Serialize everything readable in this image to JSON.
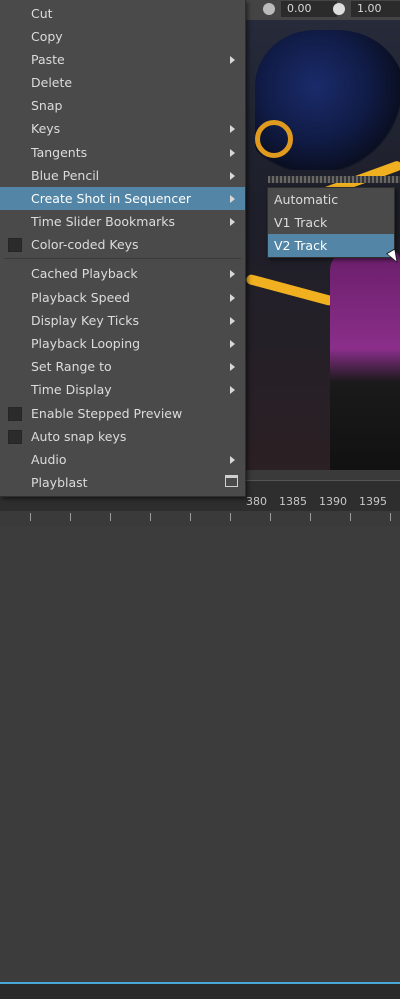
{
  "viewport": {
    "field_left": "0.00",
    "field_right": "1.00"
  },
  "menu": {
    "items": [
      {
        "label": "Cut",
        "submenu": false
      },
      {
        "label": "Copy",
        "submenu": false
      },
      {
        "label": "Paste",
        "submenu": true
      },
      {
        "label": "Delete",
        "submenu": false
      },
      {
        "label": "Snap",
        "submenu": false
      },
      {
        "label": "Keys",
        "submenu": true
      },
      {
        "label": "Tangents",
        "submenu": true
      },
      {
        "label": "Blue Pencil",
        "submenu": true
      },
      {
        "label": "Create Shot in Sequencer",
        "submenu": true,
        "active": true
      },
      {
        "label": "Time Slider Bookmarks",
        "submenu": true
      },
      {
        "label": "Color-coded Keys",
        "checkbox": true
      },
      {
        "label": "Cached Playback",
        "submenu": true
      },
      {
        "label": "Playback Speed",
        "submenu": true
      },
      {
        "label": "Display Key Ticks",
        "submenu": true
      },
      {
        "label": "Playback Looping",
        "submenu": true
      },
      {
        "label": "Set Range to",
        "submenu": true
      },
      {
        "label": "Time Display",
        "submenu": true
      },
      {
        "label": "Enable Stepped Preview",
        "checkbox": true
      },
      {
        "label": "Auto snap keys",
        "checkbox": true
      },
      {
        "label": "Audio",
        "submenu": true
      },
      {
        "label": "Playblast",
        "option_box": true
      }
    ]
  },
  "submenu": {
    "items": [
      {
        "label": "Automatic"
      },
      {
        "label": "V1 Track"
      },
      {
        "label": "V2 Track",
        "active": true
      }
    ]
  },
  "timeline": {
    "frames": [
      "380",
      "1385",
      "1390",
      "1395"
    ]
  },
  "colors": {
    "menu_bg": "#4a4a4a",
    "highlight": "#5285a6",
    "text": "#dcdcdc",
    "timeline_accent": "#4aa8d8"
  }
}
